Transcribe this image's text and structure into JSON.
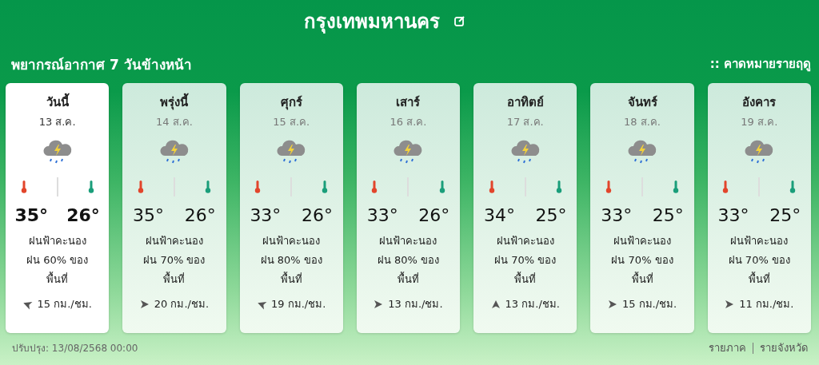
{
  "header": {
    "title": "กรุงเทพมหานคร"
  },
  "subtitle": "พยากรณ์อากาศ 7 วันข้างหน้า",
  "season_link": ":: คาดหมายรายฤดู",
  "days": [
    {
      "day": "วันนี้",
      "date": "13 ส.ค.",
      "selected": true,
      "high": "35°",
      "low": "26°",
      "description": "ฝนฟ้าคะนอง\nฝน 60% ของ\nพื้นที่",
      "wind": {
        "kind": "west",
        "speed": "15 กม./ชม."
      }
    },
    {
      "day": "พรุ่งนี้",
      "date": "14 ส.ค.",
      "selected": false,
      "high": "35°",
      "low": "26°",
      "description": "ฝนฟ้าคะนอง\nฝน 70% ของ\nพื้นที่",
      "wind": {
        "kind": "east",
        "speed": "20 กม./ชม."
      }
    },
    {
      "day": "ศุกร์",
      "date": "15 ส.ค.",
      "selected": false,
      "high": "33°",
      "low": "26°",
      "description": "ฝนฟ้าคะนอง\nฝน 80% ของ\nพื้นที่",
      "wind": {
        "kind": "west",
        "speed": "19 กม./ชม."
      }
    },
    {
      "day": "เสาร์",
      "date": "16 ส.ค.",
      "selected": false,
      "high": "33°",
      "low": "26°",
      "description": "ฝนฟ้าคะนอง\nฝน 80% ของ\nพื้นที่",
      "wind": {
        "kind": "east",
        "speed": "13 กม./ชม."
      }
    },
    {
      "day": "อาทิตย์",
      "date": "17 ส.ค.",
      "selected": false,
      "high": "34°",
      "low": "25°",
      "description": "ฝนฟ้าคะนอง\nฝน 70% ของ\nพื้นที่",
      "wind": {
        "kind": "north",
        "speed": "13 กม./ชม."
      }
    },
    {
      "day": "จันทร์",
      "date": "18 ส.ค.",
      "selected": false,
      "high": "33°",
      "low": "25°",
      "description": "ฝนฟ้าคะนอง\nฝน 70% ของ\nพื้นที่",
      "wind": {
        "kind": "east",
        "speed": "15 กม./ชม."
      }
    },
    {
      "day": "อังคาร",
      "date": "19 ส.ค.",
      "selected": false,
      "high": "33°",
      "low": "25°",
      "description": "ฝนฟ้าคะนอง\nฝน 70% ของ\nพื้นที่",
      "wind": {
        "kind": "east",
        "speed": "11 กม./ชม."
      }
    }
  ],
  "updated": "ปรับปรุง: 13/08/2568 00:00",
  "footer_links": [
    "รายภาค",
    "รายจังหวัด"
  ]
}
